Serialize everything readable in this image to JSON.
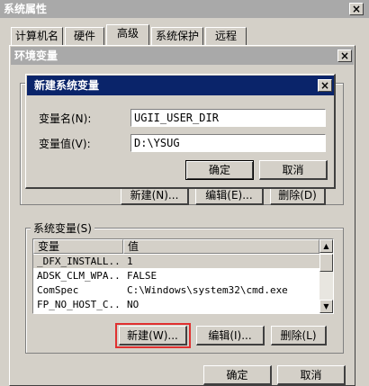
{
  "outer_window": {
    "title": "系统属性",
    "close": "×",
    "tabs": [
      "计算机名",
      "硬件",
      "高级",
      "系统保护",
      "远程"
    ]
  },
  "env_dialog": {
    "title": "环境变量",
    "close": "×",
    "user_buttons": [
      "新建(N)...",
      "编辑(E)...",
      "删除(D)"
    ],
    "system_group_label": "系统变量(S)",
    "columns": [
      "变量",
      "值"
    ],
    "rows": [
      {
        "name": "_DFX_INSTALL...",
        "value": "1",
        "selected": true
      },
      {
        "name": "ADSK_CLM_WPA...",
        "value": "FALSE",
        "selected": false
      },
      {
        "name": "ComSpec",
        "value": "C:\\Windows\\system32\\cmd.exe",
        "selected": false
      },
      {
        "name": "FP_NO_HOST_C...",
        "value": "NO",
        "selected": false
      }
    ],
    "system_buttons": {
      "new": "新建(W)...",
      "edit": "编辑(I)...",
      "delete": "删除(L)"
    },
    "ok": "确定",
    "cancel": "取消"
  },
  "new_var_dialog": {
    "title": "新建系统变量",
    "close": "×",
    "name_label": "变量名(N):",
    "name_value": "UGII_USER_DIR",
    "value_label": "变量值(V):",
    "value_value": "D:\\YSUG",
    "ok": "确定",
    "cancel": "取消"
  },
  "colors": {
    "highlight": "#0a246a",
    "focus_box": "#e03030",
    "selected_row": "#d4d0c8"
  }
}
